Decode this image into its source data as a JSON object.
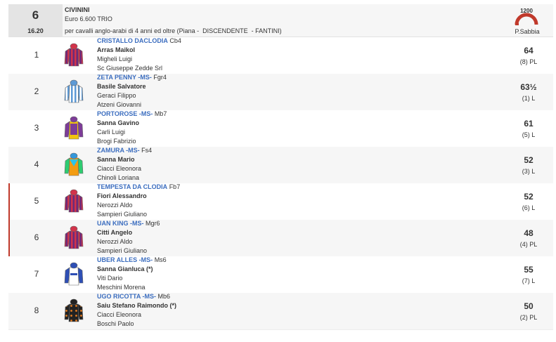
{
  "race": {
    "number": "6",
    "time": "16.20",
    "name": "CIVININI",
    "prize": "Euro 6.600 TRIO",
    "conditions": "per cavalli anglo-arabi di 4 anni ed oltre (Piana -  DISCENDENTE  - FANTINI)",
    "track_sign": "1200",
    "track_label": "P.Sabbia"
  },
  "colors": {
    "link": "#3b6dbf",
    "header_bg": "#f6f6f6",
    "race_box_bg": "#e4e4e4",
    "track_red": "#c0392b",
    "marker": "#c0392b"
  },
  "runners": [
    {
      "pos": "1",
      "horse": "CRISTALLO DACLODIA",
      "code": "Cb4",
      "jockey": "Arras Maikol",
      "trainer": "Migheli Luigi",
      "owner": "Sc Giuseppe Zedde Srl",
      "weight": "64",
      "form": "(8) PL",
      "silks_icon": "silks-purple-red-stripes-icon"
    },
    {
      "pos": "2",
      "horse": "ZETA PENNY -MS-",
      "code": "Fgr4",
      "jockey": "Basile Salvatore",
      "trainer": "Geraci Filippo",
      "owner": "Atzeni Giovanni",
      "weight": "63½",
      "form": "(1) L",
      "silks_icon": "silks-lightblue-white-stripes-icon"
    },
    {
      "pos": "3",
      "horse": "PORTOROSE -MS-",
      "code": "Mb7",
      "jockey": "Sanna Gavino",
      "trainer": "Carli Luigi",
      "owner": "Brogi Fabrizio",
      "weight": "61",
      "form": "(5) L",
      "silks_icon": "silks-purple-yellow-icon"
    },
    {
      "pos": "4",
      "horse": "ZAMURA -MS-",
      "code": "Fs4",
      "jockey": "Sanna Mario",
      "trainer": "Ciacci Eleonora",
      "owner": "Chinoli Loriana",
      "weight": "52",
      "form": "(3) L",
      "silks_icon": "silks-cyan-orange-green-icon"
    },
    {
      "pos": "5",
      "horse": "TEMPESTA DA CLODIA",
      "code": "Fb7",
      "jockey": "Fiori Alessandro",
      "trainer": "Nerozzi Aldo",
      "owner": "Sampieri Giuliano",
      "weight": "52",
      "form": "(6) L",
      "silks_icon": "silks-purple-red-stripes-icon"
    },
    {
      "pos": "6",
      "horse": "UAN KING -MS-",
      "code": "Mgr6",
      "jockey": "Citti Angelo",
      "trainer": "Nerozzi Aldo",
      "owner": "Sampieri Giuliano",
      "weight": "48",
      "form": "(4) PL",
      "silks_icon": "silks-purple-red-stripes-icon"
    },
    {
      "pos": "7",
      "horse": "UBER ALLES -MS-",
      "code": "Ms6",
      "jockey": "Sanna Gianluca (*)",
      "trainer": "Viti Dario",
      "owner": "Meschini Morena",
      "weight": "55",
      "form": "(7) L",
      "silks_icon": "silks-blue-white-icon"
    },
    {
      "pos": "8",
      "horse": "UGO RICOTTA -MS-",
      "code": "Mb6",
      "jockey": "Saiu Stefano Raimondo (*)",
      "trainer": "Ciacci Eleonora",
      "owner": "Boschi Paolo",
      "weight": "50",
      "form": "(2) PL",
      "silks_icon": "silks-black-orange-dots-icon"
    }
  ]
}
